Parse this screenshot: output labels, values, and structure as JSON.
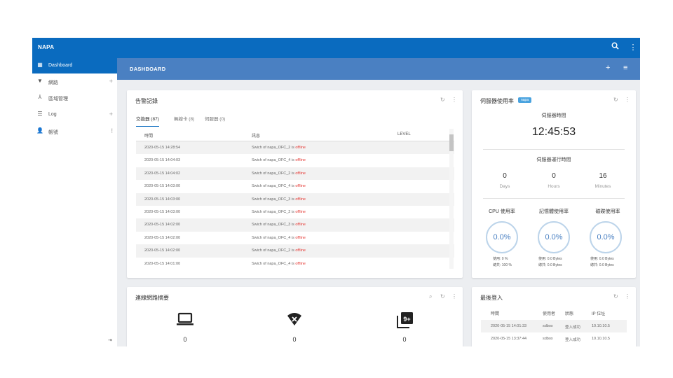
{
  "app": {
    "brand": "NAPA",
    "search_icon": "search-icon",
    "more_icon": "more-vert-icon"
  },
  "sidebar": {
    "items": [
      {
        "label": "Dashboard",
        "icon": "dashboard-icon",
        "glyph": "▦",
        "plus": "",
        "active": true
      },
      {
        "label": "網路",
        "icon": "wifi-icon",
        "glyph": "▼",
        "plus": "+"
      },
      {
        "label": "區域管理",
        "icon": "topology-icon",
        "glyph": "⅄",
        "plus": ""
      },
      {
        "label": "Log",
        "icon": "list-icon",
        "glyph": "☰",
        "plus": "+"
      },
      {
        "label": "帳號",
        "icon": "user-icon",
        "glyph": "👤",
        "plus": "!"
      }
    ],
    "logout_glyph": "⇥"
  },
  "subbar": {
    "title": "DASHBOARD",
    "add": "+",
    "filter": "≡"
  },
  "alerts": {
    "title": "告警記錄",
    "tabs": [
      "交換器 (87)",
      "無線卡 (8)",
      "伺服器 (0)"
    ],
    "columns": [
      "時間",
      "訊息",
      "LEVEL"
    ],
    "rows": [
      {
        "time": "2020-05-15 14:28:54",
        "msg": "Swich of napa_OFC_2 is ",
        "status": "offline"
      },
      {
        "time": "2020-05-15 14:04:03",
        "msg": "Swich of napa_OFC_4 is ",
        "status": "offline"
      },
      {
        "time": "2020-05-15 14:04:02",
        "msg": "Swich of napa_OFC_2 is ",
        "status": "offline"
      },
      {
        "time": "2020-05-15 14:03:00",
        "msg": "Swich of napa_OFC_4 is ",
        "status": "offline"
      },
      {
        "time": "2020-05-15 14:03:00",
        "msg": "Swich of napa_OFC_3 is ",
        "status": "offline"
      },
      {
        "time": "2020-05-15 14:03:00",
        "msg": "Swich of napa_OFC_2 is ",
        "status": "offline"
      },
      {
        "time": "2020-05-15 14:02:00",
        "msg": "Swich of napa_OFC_3 is ",
        "status": "offline"
      },
      {
        "time": "2020-05-15 14:02:00",
        "msg": "Swich of napa_OFC_4 is ",
        "status": "offline"
      },
      {
        "time": "2020-05-15 14:02:00",
        "msg": "Swich of napa_OFC_2 is ",
        "status": "offline"
      },
      {
        "time": "2020-05-15 14:01:00",
        "msg": "Swich of napa_OFC_4 is ",
        "status": "offline"
      }
    ]
  },
  "server": {
    "title": "伺服器使用率",
    "badge": "napa",
    "time_label": "伺服器時間",
    "time": "12:45:53",
    "uptime_label": "伺服器運行時間",
    "uptime": [
      {
        "value": "0",
        "unit": "Days"
      },
      {
        "value": "0",
        "unit": "Hours"
      },
      {
        "value": "16",
        "unit": "Minutes"
      }
    ],
    "meters": [
      {
        "label": "CPU 使用率",
        "value": "0.0%",
        "line1": "使用: 0 %",
        "line2": "總共: 100 %"
      },
      {
        "label": "記憶體使用率",
        "value": "0.0%",
        "line1": "使用: 0.0 Bytes",
        "line2": "總共: 0.0 Bytes"
      },
      {
        "label": "磁碟使用率",
        "value": "0.0%",
        "line1": "使用: 0.0 Bytes",
        "line2": "總共: 0.0 Bytes"
      }
    ]
  },
  "network": {
    "title": "連線網路摘要",
    "items": [
      {
        "icon": "laptop-icon",
        "count": "0"
      },
      {
        "icon": "wifi-off-icon",
        "count": "0"
      },
      {
        "icon": "filter-9-plus-icon",
        "count": "0"
      }
    ]
  },
  "logins": {
    "title": "最後登入",
    "columns": [
      "時間",
      "使用者",
      "狀態",
      "IP 位址"
    ],
    "rows": [
      {
        "time": "2020-05-15 14:01:33",
        "user": "sdbox",
        "status": "登入成功",
        "ip": "10.10.10.5"
      },
      {
        "time": "2020-05-15 13:37:44",
        "user": "sdbox",
        "status": "登入成功",
        "ip": "10.10.10.5"
      }
    ]
  },
  "tool_icons": {
    "search": "⌕",
    "refresh": "↻",
    "more": "⋮"
  }
}
